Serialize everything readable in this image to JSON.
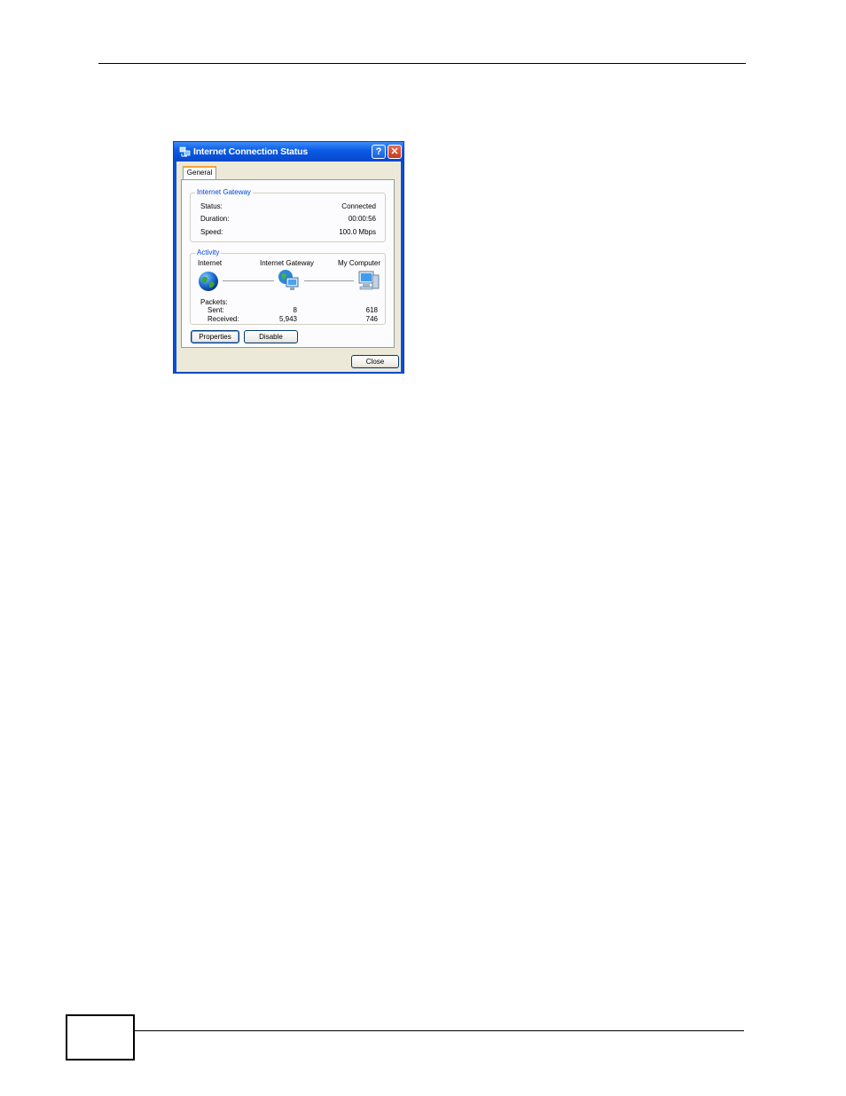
{
  "window": {
    "title": "Internet Connection Status",
    "help_glyph": "?",
    "close_glyph": "✕"
  },
  "tabs": [
    {
      "label": "General"
    }
  ],
  "internet_gateway": {
    "legend": "Internet Gateway",
    "rows": [
      {
        "label": "Status:",
        "value": "Connected"
      },
      {
        "label": "Duration:",
        "value": "00:00:56"
      },
      {
        "label": "Speed:",
        "value": "100.0 Mbps"
      }
    ]
  },
  "activity": {
    "legend": "Activity",
    "nodes": [
      {
        "label": "Internet",
        "icon": "globe-icon"
      },
      {
        "label": "Internet Gateway",
        "icon": "gateway-icon"
      },
      {
        "label": "My Computer",
        "icon": "computer-icon"
      }
    ],
    "packets_label": "Packets:",
    "sent": {
      "label": "Sent:",
      "gateway": "8",
      "computer": "618"
    },
    "received": {
      "label": "Received:",
      "gateway": "5,943",
      "computer": "746"
    }
  },
  "buttons": {
    "properties": "Properties",
    "disable": "Disable",
    "close": "Close"
  },
  "colors": {
    "title_bar": "#0a5ae6",
    "client_bg": "#ece9d8",
    "legend_text": "#0046d5"
  }
}
